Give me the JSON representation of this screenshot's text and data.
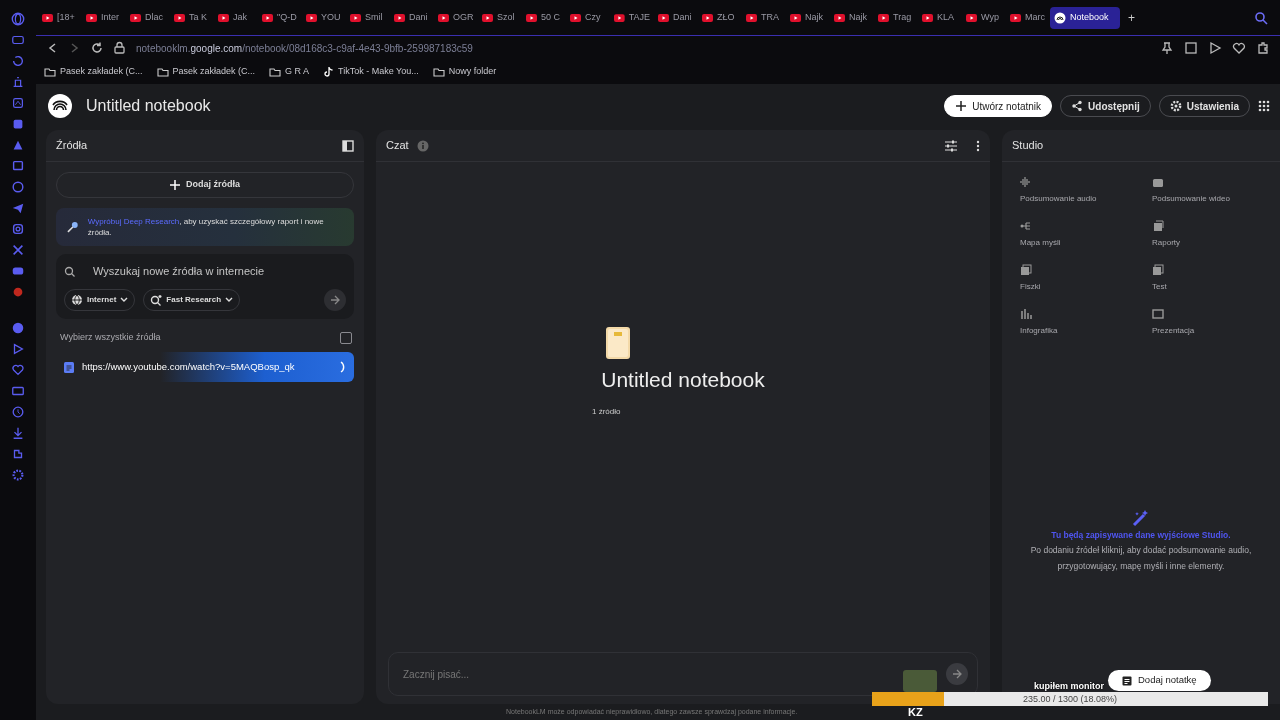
{
  "browser": {
    "tabs": [
      {
        "label": "[18+",
        "selected": false
      },
      {
        "label": "Inter",
        "selected": false
      },
      {
        "label": "Dlac",
        "selected": false
      },
      {
        "label": "Ta K",
        "selected": false
      },
      {
        "label": "Jak",
        "selected": false
      },
      {
        "label": "\"Q-D",
        "selected": false
      },
      {
        "label": "YOU",
        "selected": false
      },
      {
        "label": "Smil",
        "selected": false
      },
      {
        "label": "Dani",
        "selected": false
      },
      {
        "label": "OGR",
        "selected": false
      },
      {
        "label": "Szol",
        "selected": false
      },
      {
        "label": "50 C",
        "selected": false
      },
      {
        "label": "Czy",
        "selected": false
      },
      {
        "label": "TAJE",
        "selected": false
      },
      {
        "label": "Dani",
        "selected": false
      },
      {
        "label": "ZŁO",
        "selected": false
      },
      {
        "label": "TRA",
        "selected": false
      },
      {
        "label": "Najk",
        "selected": false
      },
      {
        "label": "Najk",
        "selected": false
      },
      {
        "label": "Trag",
        "selected": false
      },
      {
        "label": "KLA",
        "selected": false
      },
      {
        "label": "Wyp",
        "selected": false
      },
      {
        "label": "Marc",
        "selected": false
      },
      {
        "label": "Notebook",
        "selected": true
      }
    ],
    "new_tab": "+",
    "url": [
      "notebooklm.",
      "google.com",
      "/notebook/08d168c3-c9af-4e43-9bfb-259987183c59"
    ],
    "bookmarks": [
      {
        "label": "Pasek zakładek (C...",
        "kind": "folder"
      },
      {
        "label": "Pasek zakładek (C...",
        "kind": "folder"
      },
      {
        "label": "G R A",
        "kind": "folder"
      },
      {
        "label": "TikTok - Make You...",
        "kind": "site"
      },
      {
        "label": "Nowy folder",
        "kind": "folder"
      }
    ]
  },
  "app": {
    "title": "Untitled notebook",
    "actions": [
      "Utwórz notatnik",
      "Udostępnij",
      "Ustawienia"
    ]
  },
  "sources": {
    "title": "Źródła",
    "add_button": "Dodaj źródła",
    "promo": {
      "link": "Wypróbuj Deep Research",
      "text": ", aby uzyskać szczegółowy raport i nowe źródła."
    },
    "search": {
      "placeholder": "Wyszukaj nowe źródła w internecie"
    },
    "chips": [
      "Internet",
      "Fast Research"
    ],
    "select_all": {
      "label": "Wybierz wszystkie źródła",
      "checked": false
    },
    "items": [
      {
        "label": "https://www.youtube.com/watch?v=5MAQBosp_qk",
        "loading": true
      }
    ]
  },
  "chat": {
    "title": "Czat",
    "notebook_title": "Untitled notebook",
    "source_count": "1 źródło",
    "input": {
      "placeholder": "Zacznij pisać..."
    },
    "disclaimer": "NotebookLM może odpowiadać nieprawidłowo, dlatego zawsze sprawdzaj podane informacje."
  },
  "studio": {
    "title": "Studio",
    "tiles": [
      "Podsumowanie audio",
      "Podsumowanie wideo",
      "Mapa myśli",
      "Raporty",
      "Fiszki",
      "Test",
      "Infografika",
      "Prezentacja"
    ],
    "empty_title": "Tu będą zapisywane dane wyjściowe Studio.",
    "empty_text": "Po dodaniu źródeł kliknij, aby dodać podsumowanie audio, przygotowujący, mapę myśli i inne elementy.",
    "add_note": "Dodaj notatkę"
  },
  "overlay": {
    "caption": "kupiłem monitor",
    "progress": {
      "level": 0.1808,
      "reading": "235.00 / 1300 (18.08%)"
    },
    "tag": "KZ"
  }
}
